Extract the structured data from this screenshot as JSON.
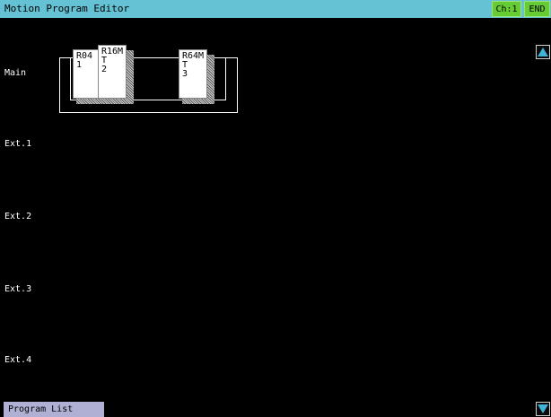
{
  "title_bar": {
    "title": "Motion Program Editor",
    "channel_label": "Ch:1",
    "end_label": "END"
  },
  "rows": [
    {
      "label": "Main"
    },
    {
      "label": "Ext.1"
    },
    {
      "label": "Ext.2"
    },
    {
      "label": "Ext.3"
    },
    {
      "label": "Ext.4"
    }
  ],
  "main_base": {
    "modules": [
      {
        "model": "R04",
        "sub": "",
        "slot": "1"
      },
      {
        "model": "R16M",
        "sub": "T",
        "slot": "2"
      },
      {
        "model": "R64M",
        "sub": "T",
        "slot": "3"
      }
    ]
  },
  "footer": {
    "program_list_label": "Program List"
  },
  "scroll": {
    "up_icon": "scroll-up-arrow",
    "down_icon": "scroll-down-arrow",
    "arrow_color": "#3fb2d8"
  },
  "colors": {
    "title_bar": "#64c2d4",
    "button_green": "#66cc33",
    "tab": "#b0b0d4",
    "background": "#000000"
  }
}
